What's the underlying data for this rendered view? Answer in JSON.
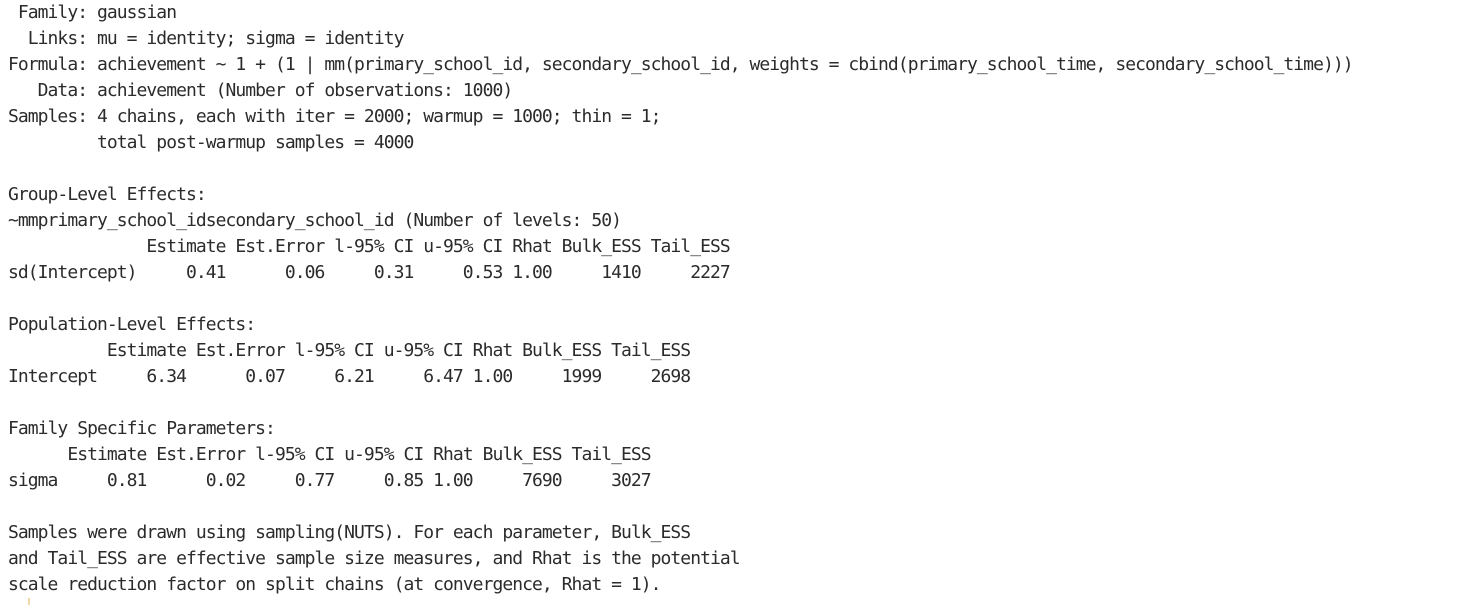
{
  "model_info": {
    "family": " Family: gaussian",
    "links": "  Links: mu = identity; sigma = identity",
    "formula": "Formula: achievement ~ 1 + (1 | mm(primary_school_id, secondary_school_id, weights = cbind(primary_school_time, secondary_school_time)))",
    "data": "   Data: achievement (Number of observations: 1000)",
    "samples": "Samples: 4 chains, each with iter = 2000; warmup = 1000; thin = 1;",
    "samples_total": "         total post-warmup samples = 4000"
  },
  "group_level": {
    "heading": "Group-Level Effects:",
    "grouping": "~mmprimary_school_idsecondary_school_id (Number of levels: 50)",
    "header_row": "              Estimate Est.Error l-95% CI u-95% CI Rhat Bulk_ESS Tail_ESS",
    "rows": [
      "sd(Intercept)     0.41      0.06     0.31     0.53 1.00     1410     2227"
    ]
  },
  "population_level": {
    "heading": "Population-Level Effects:",
    "header_row": "          Estimate Est.Error l-95% CI u-95% CI Rhat Bulk_ESS Tail_ESS",
    "rows": [
      "Intercept     6.34      0.07     6.21     6.47 1.00     1999     2698"
    ]
  },
  "family_specific": {
    "heading": "Family Specific Parameters:",
    "header_row": "      Estimate Est.Error l-95% CI u-95% CI Rhat Bulk_ESS Tail_ESS",
    "rows": [
      "sigma     0.81      0.02     0.77     0.85 1.00     7690     3027"
    ]
  },
  "footnote": {
    "line1": "Samples were drawn using sampling(NUTS). For each parameter, Bulk_ESS",
    "line2": "and Tail_ESS are effective sample size measures, and Rhat is the potential",
    "line3": "scale reduction factor on split chains (at convergence, Rhat = 1)."
  },
  "colors": {
    "text": "#2b2b2b",
    "background": "#ffffff",
    "cursor": "#f0d9a8"
  }
}
